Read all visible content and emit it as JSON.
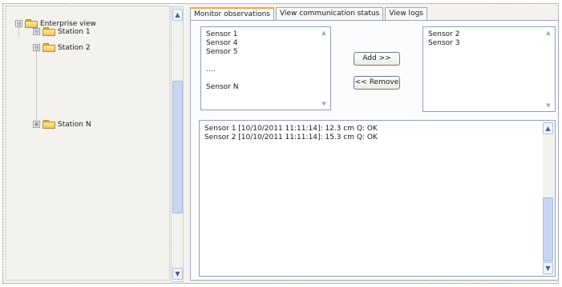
{
  "tree": {
    "root": {
      "label": "Enterprise view",
      "expander": "⊟"
    },
    "stations": [
      {
        "label": "Station 1",
        "expander": "⊟"
      },
      {
        "label": "Station 2",
        "expander": "⊟"
      },
      {
        "label": "Station N",
        "expander": "⊞"
      }
    ]
  },
  "tabs": [
    {
      "label": "Monitor observations",
      "active": true
    },
    {
      "label": "View communication status",
      "active": false
    },
    {
      "label": "View logs",
      "active": false
    }
  ],
  "available_sensors": [
    "Sensor 1",
    "Sensor 4",
    "Sensor 5",
    "",
    "....",
    "",
    "Sensor N"
  ],
  "selected_sensors": [
    "Sensor 2",
    "Sensor 3"
  ],
  "buttons": {
    "add": "Add >>",
    "remove": "<< Remove"
  },
  "log": [
    "Sensor 1 [10/10/2011 11:11:14]: 12.3 cm Q: OK",
    "Sensor 2 [10/10/2011 11:11:14]: 15.3 cm Q: OK"
  ],
  "icons": {
    "folder": "folder-icon",
    "scroll_up": "▲",
    "scroll_down": "▼"
  },
  "colors": {
    "active_tab_accent": "#f3a637",
    "folder": "#f2c65a",
    "scroll_thumb": "#c9d6f1"
  }
}
